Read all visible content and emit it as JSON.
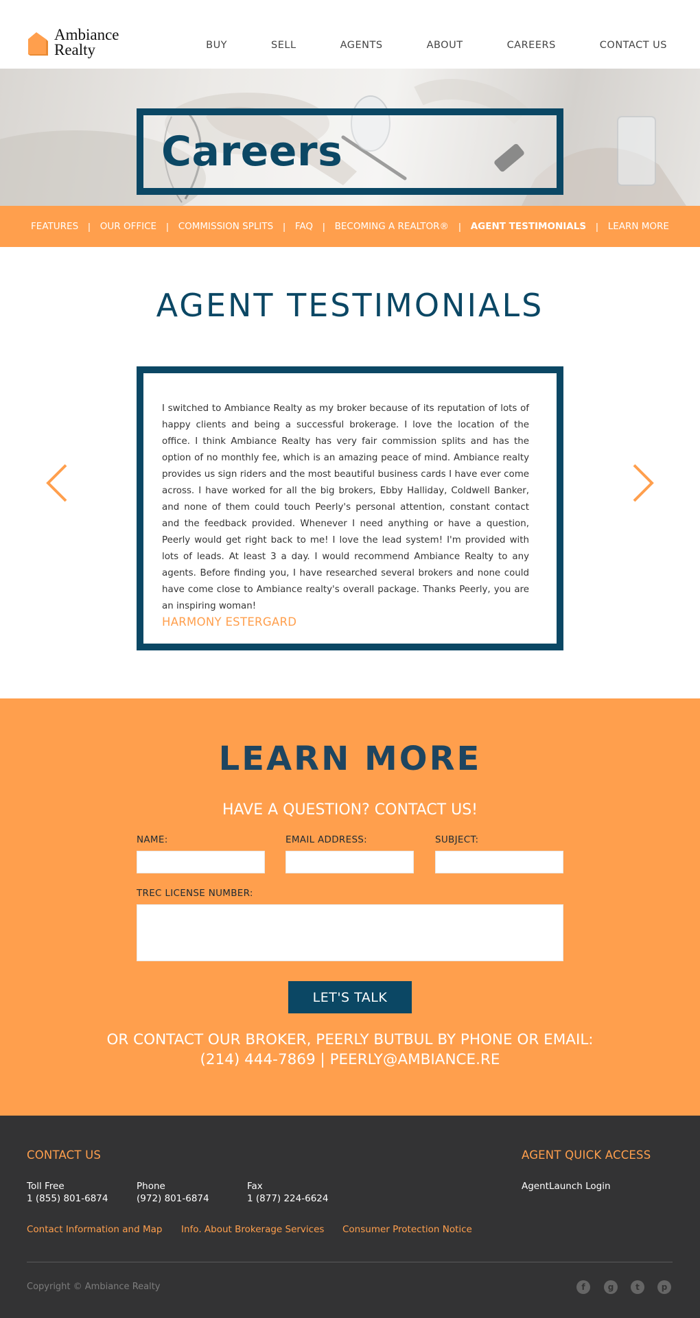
{
  "brand": {
    "name_line1": "Ambiance",
    "name_line2": "Realty",
    "accent_color": "#ff9f4d",
    "primary_color": "#0b4764"
  },
  "nav": {
    "items": [
      "BUY",
      "SELL",
      "AGENTS",
      "ABOUT",
      "CAREERS",
      "CONTACT US"
    ]
  },
  "hero": {
    "title": "Careers"
  },
  "subnav": {
    "items": [
      "FEATURES",
      "OUR OFFICE",
      "COMMISSION SPLITS",
      "FAQ",
      "BECOMING A REALTOR®",
      "AGENT TESTIMONIALS",
      "LEARN MORE"
    ],
    "active": "AGENT TESTIMONIALS",
    "separator": "|"
  },
  "testimonials": {
    "heading": "AGENT TESTIMONIALS",
    "quote": "I switched to Ambiance Realty as my broker because of its reputation of lots of happy clients and being a successful brokerage. I love the location of the office. I think Ambiance Realty has very fair commission splits and has the option of no monthly fee, which is an amazing peace of mind. Ambiance realty provides us sign riders and the most beautiful business cards I have ever come across. I have worked for all the big brokers, Ebby Halliday, Coldwell Banker, and none of them could touch Peerly's personal attention, constant contact and the feedback provided. Whenever I need anything or have a question, Peerly would get right back to me! I love the lead system! I'm provided with lots of leads. At least 3 a day. I would recommend Ambiance Realty to any agents. Before finding you, I have researched several brokers and none could have come close to Ambiance realty's overall package. Thanks Peerly, you are an inspiring woman!",
    "author": "HARMONY ESTERGARD",
    "prev_icon": "chevron-left-icon",
    "next_icon": "chevron-right-icon"
  },
  "learn_more": {
    "heading": "LEARN MORE",
    "subheading": "HAVE A QUESTION? CONTACT US!",
    "fields": {
      "name_label": "NAME:",
      "name_value": "",
      "email_label": "EMAIL ADDRESS:",
      "email_value": "",
      "subject_label": "SUBJECT:",
      "subject_value": "",
      "trec_label": "TREC LICENSE NUMBER:",
      "trec_value": ""
    },
    "button_label": "LET'S TALK",
    "broker_line1": "OR CONTACT OUR BROKER, PEERLY BUTBUL BY PHONE OR EMAIL:",
    "broker_line2": "(214) 444-7869 | PEERLY@AMBIANCE.RE"
  },
  "footer": {
    "contact_heading": "CONTACT US",
    "toll_free_label": "Toll Free",
    "toll_free": "1 (855) 801-6874",
    "phone_label": "Phone",
    "phone": "(972) 801-6874",
    "fax_label": "Fax",
    "fax": "1 (877) 224-6624",
    "links": [
      "Contact Information and Map",
      "Info. About Brokerage Services",
      "Consumer Protection Notice"
    ],
    "quick_access_heading": "AGENT QUICK ACCESS",
    "quick_access_link": "AgentLaunch Login",
    "copyright": "Copyright © Ambiance Realty",
    "social": [
      {
        "icon": "facebook-icon",
        "glyph": "f"
      },
      {
        "icon": "google-plus-icon",
        "glyph": "g"
      },
      {
        "icon": "twitter-icon",
        "glyph": "t"
      },
      {
        "icon": "pinterest-icon",
        "glyph": "p"
      }
    ]
  }
}
